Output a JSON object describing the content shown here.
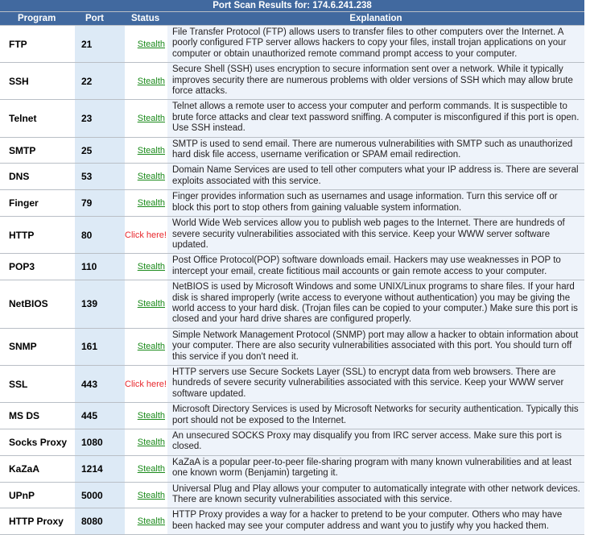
{
  "title": "Port Scan Results for: 174.6.241.238",
  "columns": {
    "program": "Program",
    "port": "Port",
    "status": "Status",
    "explanation": "Explanation"
  },
  "colors": {
    "header_bg": "#41699f",
    "header_text": "#ffffff",
    "port_cell_bg": "#ddeaf6",
    "explanation_bg": "#eef3fa",
    "stealth_green": "#1a8a1a",
    "click_here_red": "#e8272c",
    "row_border": "#b9bfc6"
  },
  "status_labels": {
    "stealth": "Stealth",
    "click_here": "Click here!"
  },
  "rows": [
    {
      "program": "FTP",
      "port": "21",
      "status": "Stealth",
      "status_kind": "stealth",
      "explanation": "File Transfer Protocol (FTP) allows users to transfer files to other computers over the Internet. A poorly configured FTP server allows hackers to copy your files, install trojan applications on your computer or obtain unauthorized remote command prompt access to your computer."
    },
    {
      "program": "SSH",
      "port": "22",
      "status": "Stealth",
      "status_kind": "stealth",
      "explanation": "Secure Shell (SSH) uses encryption to secure information sent over a network. While it typically improves security there are numerous problems with older versions of SSH which may allow brute force attacks."
    },
    {
      "program": "Telnet",
      "port": "23",
      "status": "Stealth",
      "status_kind": "stealth",
      "explanation": "Telnet allows a remote user to access your computer and perform commands. It is suspectible to brute force attacks and clear text password sniffing. A computer is misconfigured if this port is open. Use SSH instead."
    },
    {
      "program": "SMTP",
      "port": "25",
      "status": "Stealth",
      "status_kind": "stealth",
      "explanation": "SMTP is used to send email. There are numerous vulnerabilities with SMTP such as unauthorized hard disk file access, username verification or SPAM email redirection."
    },
    {
      "program": "DNS",
      "port": "53",
      "status": "Stealth",
      "status_kind": "stealth",
      "explanation": "Domain Name Services are used to tell other computers what your IP address is. There are several exploits associated with this service."
    },
    {
      "program": "Finger",
      "port": "79",
      "status": "Stealth",
      "status_kind": "stealth",
      "explanation": "Finger provides information such as usernames and usage information. Turn this service off or block this port to stop others from gaining valuable system information."
    },
    {
      "program": "HTTP",
      "port": "80",
      "status": "Click here!",
      "status_kind": "click",
      "explanation": "World Wide Web services allow you to publish web pages to the Internet. There are hundreds of severe security vulnerabilities associated with this service. Keep your WWW server software updated."
    },
    {
      "program": "POP3",
      "port": "110",
      "status": "Stealth",
      "status_kind": "stealth",
      "explanation": "Post Office Protocol(POP) software downloads email. Hackers may use weaknesses in POP to intercept your email, create fictitious mail accounts or gain remote access to your computer."
    },
    {
      "program": "NetBIOS",
      "port": "139",
      "status": "Stealth",
      "status_kind": "stealth",
      "explanation": "NetBIOS is used by Microsoft Windows and some UNIX/Linux programs to share files. If your hard disk is shared improperly (write access to everyone without authentication) you may be giving the world access to your hard disk. (Trojan files can be copied to your computer.) Make sure this port is closed and your hard drive shares are configured properly."
    },
    {
      "program": "SNMP",
      "port": "161",
      "status": "Stealth",
      "status_kind": "stealth",
      "explanation": "Simple Network Management Protocol (SNMP) port may allow a hacker to obtain information about your computer. There are also security vulnerabilities associated with this port. You should turn off this service if you don't need it."
    },
    {
      "program": "SSL",
      "port": "443",
      "status": "Click here!",
      "status_kind": "click",
      "explanation": "HTTP servers use Secure Sockets Layer (SSL) to encrypt data from web browsers. There are hundreds of severe security vulnerabilities associated with this service. Keep your WWW server software updated."
    },
    {
      "program": "MS DS",
      "port": "445",
      "status": "Stealth",
      "status_kind": "stealth",
      "explanation": "Microsoft Directory Services is used by Microsoft Networks for security authentication. Typically this port should not be exposed to the Internet."
    },
    {
      "program": "Socks Proxy",
      "port": "1080",
      "status": "Stealth",
      "status_kind": "stealth",
      "explanation": "An unsecured SOCKS Proxy may disqualify you from IRC server access. Make sure this port is closed."
    },
    {
      "program": "KaZaA",
      "port": "1214",
      "status": "Stealth",
      "status_kind": "stealth",
      "explanation": "KaZaA is a popular peer-to-peer file-sharing program with many known vulnerabilities and at least one known worm (Benjamin) targeting it."
    },
    {
      "program": "UPnP",
      "port": "5000",
      "status": "Stealth",
      "status_kind": "stealth",
      "explanation": "Universal Plug and Play allows your computer to automatically integrate with other network devices. There are known security vulnerabilities associated with this service."
    },
    {
      "program": "HTTP Proxy",
      "port": "8080",
      "status": "Stealth",
      "status_kind": "stealth",
      "explanation": "HTTP Proxy provides a way for a hacker to pretend to be your computer. Others who may have been hacked may see your computer address and want you to justify why you hacked them."
    }
  ]
}
